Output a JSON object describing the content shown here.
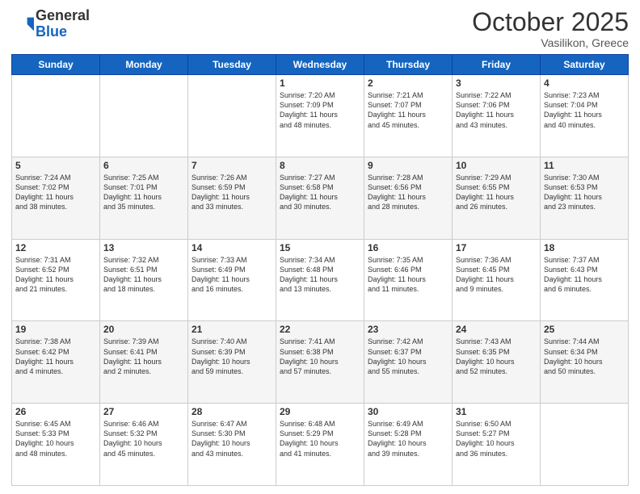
{
  "header": {
    "logo_general": "General",
    "logo_blue": "Blue",
    "month_title": "October 2025",
    "location": "Vasilikon, Greece"
  },
  "weekdays": [
    "Sunday",
    "Monday",
    "Tuesday",
    "Wednesday",
    "Thursday",
    "Friday",
    "Saturday"
  ],
  "weeks": [
    [
      {
        "day": "",
        "info": ""
      },
      {
        "day": "",
        "info": ""
      },
      {
        "day": "",
        "info": ""
      },
      {
        "day": "1",
        "info": "Sunrise: 7:20 AM\nSunset: 7:09 PM\nDaylight: 11 hours\nand 48 minutes."
      },
      {
        "day": "2",
        "info": "Sunrise: 7:21 AM\nSunset: 7:07 PM\nDaylight: 11 hours\nand 45 minutes."
      },
      {
        "day": "3",
        "info": "Sunrise: 7:22 AM\nSunset: 7:06 PM\nDaylight: 11 hours\nand 43 minutes."
      },
      {
        "day": "4",
        "info": "Sunrise: 7:23 AM\nSunset: 7:04 PM\nDaylight: 11 hours\nand 40 minutes."
      }
    ],
    [
      {
        "day": "5",
        "info": "Sunrise: 7:24 AM\nSunset: 7:02 PM\nDaylight: 11 hours\nand 38 minutes."
      },
      {
        "day": "6",
        "info": "Sunrise: 7:25 AM\nSunset: 7:01 PM\nDaylight: 11 hours\nand 35 minutes."
      },
      {
        "day": "7",
        "info": "Sunrise: 7:26 AM\nSunset: 6:59 PM\nDaylight: 11 hours\nand 33 minutes."
      },
      {
        "day": "8",
        "info": "Sunrise: 7:27 AM\nSunset: 6:58 PM\nDaylight: 11 hours\nand 30 minutes."
      },
      {
        "day": "9",
        "info": "Sunrise: 7:28 AM\nSunset: 6:56 PM\nDaylight: 11 hours\nand 28 minutes."
      },
      {
        "day": "10",
        "info": "Sunrise: 7:29 AM\nSunset: 6:55 PM\nDaylight: 11 hours\nand 26 minutes."
      },
      {
        "day": "11",
        "info": "Sunrise: 7:30 AM\nSunset: 6:53 PM\nDaylight: 11 hours\nand 23 minutes."
      }
    ],
    [
      {
        "day": "12",
        "info": "Sunrise: 7:31 AM\nSunset: 6:52 PM\nDaylight: 11 hours\nand 21 minutes."
      },
      {
        "day": "13",
        "info": "Sunrise: 7:32 AM\nSunset: 6:51 PM\nDaylight: 11 hours\nand 18 minutes."
      },
      {
        "day": "14",
        "info": "Sunrise: 7:33 AM\nSunset: 6:49 PM\nDaylight: 11 hours\nand 16 minutes."
      },
      {
        "day": "15",
        "info": "Sunrise: 7:34 AM\nSunset: 6:48 PM\nDaylight: 11 hours\nand 13 minutes."
      },
      {
        "day": "16",
        "info": "Sunrise: 7:35 AM\nSunset: 6:46 PM\nDaylight: 11 hours\nand 11 minutes."
      },
      {
        "day": "17",
        "info": "Sunrise: 7:36 AM\nSunset: 6:45 PM\nDaylight: 11 hours\nand 9 minutes."
      },
      {
        "day": "18",
        "info": "Sunrise: 7:37 AM\nSunset: 6:43 PM\nDaylight: 11 hours\nand 6 minutes."
      }
    ],
    [
      {
        "day": "19",
        "info": "Sunrise: 7:38 AM\nSunset: 6:42 PM\nDaylight: 11 hours\nand 4 minutes."
      },
      {
        "day": "20",
        "info": "Sunrise: 7:39 AM\nSunset: 6:41 PM\nDaylight: 11 hours\nand 2 minutes."
      },
      {
        "day": "21",
        "info": "Sunrise: 7:40 AM\nSunset: 6:39 PM\nDaylight: 10 hours\nand 59 minutes."
      },
      {
        "day": "22",
        "info": "Sunrise: 7:41 AM\nSunset: 6:38 PM\nDaylight: 10 hours\nand 57 minutes."
      },
      {
        "day": "23",
        "info": "Sunrise: 7:42 AM\nSunset: 6:37 PM\nDaylight: 10 hours\nand 55 minutes."
      },
      {
        "day": "24",
        "info": "Sunrise: 7:43 AM\nSunset: 6:35 PM\nDaylight: 10 hours\nand 52 minutes."
      },
      {
        "day": "25",
        "info": "Sunrise: 7:44 AM\nSunset: 6:34 PM\nDaylight: 10 hours\nand 50 minutes."
      }
    ],
    [
      {
        "day": "26",
        "info": "Sunrise: 6:45 AM\nSunset: 5:33 PM\nDaylight: 10 hours\nand 48 minutes."
      },
      {
        "day": "27",
        "info": "Sunrise: 6:46 AM\nSunset: 5:32 PM\nDaylight: 10 hours\nand 45 minutes."
      },
      {
        "day": "28",
        "info": "Sunrise: 6:47 AM\nSunset: 5:30 PM\nDaylight: 10 hours\nand 43 minutes."
      },
      {
        "day": "29",
        "info": "Sunrise: 6:48 AM\nSunset: 5:29 PM\nDaylight: 10 hours\nand 41 minutes."
      },
      {
        "day": "30",
        "info": "Sunrise: 6:49 AM\nSunset: 5:28 PM\nDaylight: 10 hours\nand 39 minutes."
      },
      {
        "day": "31",
        "info": "Sunrise: 6:50 AM\nSunset: 5:27 PM\nDaylight: 10 hours\nand 36 minutes."
      },
      {
        "day": "",
        "info": ""
      }
    ]
  ]
}
